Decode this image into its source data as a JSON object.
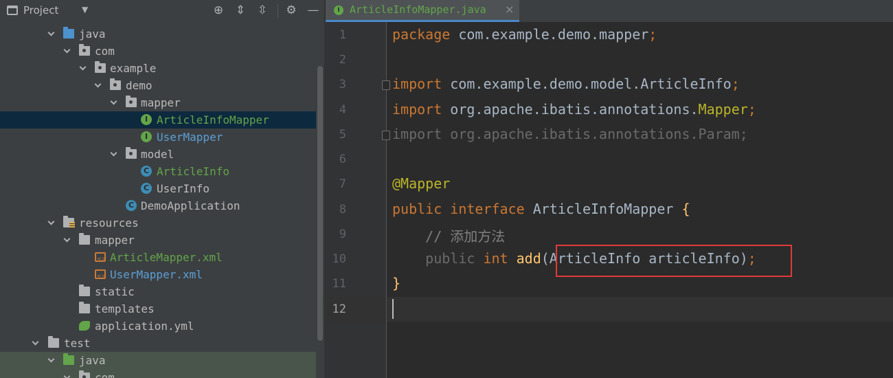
{
  "project_panel": {
    "title": "Project",
    "tree": [
      {
        "label": "java",
        "color": "default",
        "icon": "folder-blue-icon",
        "expanded": true
      },
      {
        "label": "com",
        "color": "default",
        "icon": "package-icon",
        "expanded": true
      },
      {
        "label": "example",
        "color": "default",
        "icon": "package-icon",
        "expanded": true
      },
      {
        "label": "demo",
        "color": "default",
        "icon": "package-icon",
        "expanded": true
      },
      {
        "label": "mapper",
        "color": "default",
        "icon": "package-icon",
        "expanded": true
      },
      {
        "label": "ArticleInfoMapper",
        "color": "green",
        "icon": "interface-icon",
        "selected": true
      },
      {
        "label": "UserMapper",
        "color": "blue",
        "icon": "interface-icon"
      },
      {
        "label": "model",
        "color": "default",
        "icon": "package-icon",
        "expanded": true
      },
      {
        "label": "ArticleInfo",
        "color": "green",
        "icon": "class-icon"
      },
      {
        "label": "UserInfo",
        "color": "default",
        "icon": "class-icon"
      },
      {
        "label": "DemoApplication",
        "color": "default",
        "icon": "spring-app-class-icon"
      },
      {
        "label": "resources",
        "color": "default",
        "icon": "resources-folder-icon",
        "expanded": true
      },
      {
        "label": "mapper",
        "color": "default",
        "icon": "folder-icon",
        "expanded": true
      },
      {
        "label": "ArticleMapper.xml",
        "color": "green",
        "icon": "xml-file-icon"
      },
      {
        "label": "UserMapper.xml",
        "color": "blue",
        "icon": "xml-file-icon"
      },
      {
        "label": "static",
        "color": "default",
        "icon": "folder-icon"
      },
      {
        "label": "templates",
        "color": "default",
        "icon": "folder-icon"
      },
      {
        "label": "application.yml",
        "color": "default",
        "icon": "yml-file-icon"
      },
      {
        "label": "test",
        "color": "default",
        "icon": "folder-icon",
        "expanded": true
      },
      {
        "label": "java",
        "color": "default",
        "icon": "folder-green-icon",
        "expanded": true
      },
      {
        "label": "com",
        "color": "default",
        "icon": "package-icon",
        "expanded": true
      }
    ]
  },
  "editor": {
    "tab_label": "ArticleInfoMapper.java",
    "tab_close": "×",
    "current_line": 12,
    "lines": [
      {
        "n": "1"
      },
      {
        "n": "2"
      },
      {
        "n": "3"
      },
      {
        "n": "4"
      },
      {
        "n": "5"
      },
      {
        "n": "6"
      },
      {
        "n": "7"
      },
      {
        "n": "8"
      },
      {
        "n": "9"
      },
      {
        "n": "10"
      },
      {
        "n": "11"
      },
      {
        "n": "12"
      }
    ],
    "code": {
      "l1_kw": "package",
      "l1_rest": " com.example.demo.mapper",
      "l1_semi": ";",
      "l3_kw": "import",
      "l3_rest": " com.example.demo.model.ArticleInfo",
      "l3_semi": ";",
      "l4_kw": "import",
      "l4_rest": " org.apache.ibatis.annotations.",
      "l4_ann": "Mapper",
      "l4_semi": ";",
      "l5_text": "import org.apache.ibatis.annotations.Param;",
      "l7_ann": "@Mapper",
      "l8_kw1": "public",
      "l8_kw2": " interface",
      "l8_rest": " ArticleInfoMapper ",
      "l8_brace": "{",
      "l9_comment": "    // 添加方法",
      "l10_indent": "    ",
      "l10_kw1": "public",
      "l10_kw2": " int",
      "l10_fn": " add",
      "l10_rest": "(ArticleInfo articleInfo)",
      "l10_semi": ";",
      "l11_brace": "}"
    }
  },
  "colors": {
    "keyword": "#cc7832",
    "annotation": "#bbb529",
    "comment": "#808080",
    "method": "#ffc66d",
    "text": "#a9b7c6",
    "highlight_box": "#e03a3a",
    "file_green": "#62a54a",
    "file_blue": "#5c9fd6"
  }
}
